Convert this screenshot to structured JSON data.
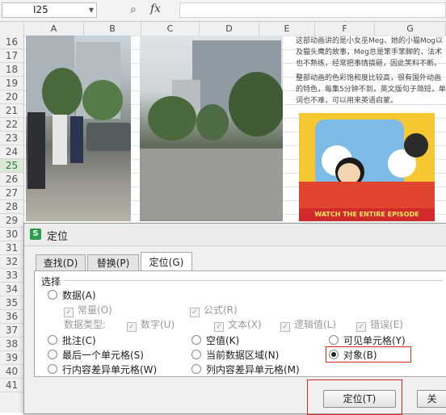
{
  "formula_bar": {
    "cell_ref": "I25",
    "fx_label": "fx",
    "zoom_icon": "search-zoom-icon"
  },
  "columns": [
    "A",
    "B",
    "C",
    "D",
    "E",
    "F",
    "G"
  ],
  "rows": [
    "16",
    "17",
    "18",
    "19",
    "20",
    "21",
    "22",
    "23",
    "24",
    "25",
    "26",
    "27",
    "28",
    "29",
    "30",
    "31",
    "32",
    "33",
    "34",
    "35",
    "36",
    "37",
    "38",
    "39",
    "40",
    "41"
  ],
  "selected_row": "25",
  "article_text": {
    "p1": "这部动画讲的是小女巫Meg、她的小猫Mog以及猫头鹰的故事，Meg总是笨手笨脚的，法术也不熟练，经常把事情搞砸，因此笑料不断。",
    "p2": "整部动画的色彩饱和度比较高，很有国外动画的特色，每集5分钟不到，英文版句子简短，单词也不难，可以用来英语启蒙。"
  },
  "cartoon_banner": "WATCH THE ENTIRE EPISODE",
  "dialog": {
    "title": "定位",
    "tabs": [
      "查找(D)",
      "替换(P)",
      "定位(G)"
    ],
    "active_tab": 2,
    "group_label": "选择",
    "options": {
      "data": "数据(A)",
      "constant": "常量(O)",
      "formula": "公式(R)",
      "data_type_label": "数据类型:",
      "number": "数字(U)",
      "text": "文本(X)",
      "logical": "逻辑值(L)",
      "error": "错误(E)",
      "comment": "批注(C)",
      "blank": "空值(K)",
      "visible_cells": "可见单元格(Y)",
      "last_cell": "最后一个单元格(S)",
      "current_region": "当前数据区域(N)",
      "objects": "对象(B)",
      "row_diff": "行内容差异单元格(W)",
      "col_diff": "列内容差异单元格(M)"
    },
    "selected_option": "objects",
    "buttons": {
      "locate": "定位(T)",
      "close_partial": "关"
    }
  },
  "colors": {
    "highlight": "#d9291c",
    "wps_green": "#2a9d4a"
  }
}
